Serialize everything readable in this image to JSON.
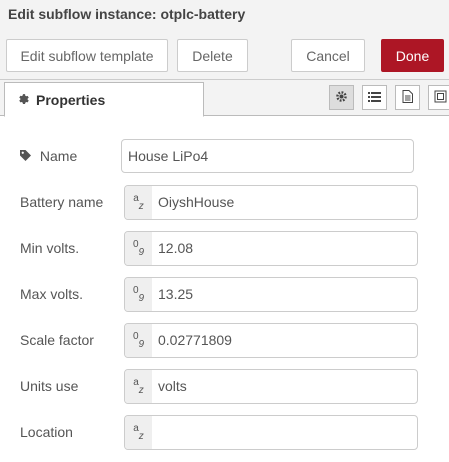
{
  "dialog": {
    "title": "Edit subflow instance: otplc-battery"
  },
  "toolbar": {
    "edit_template_label": "Edit subflow template",
    "delete_label": "Delete",
    "cancel_label": "Cancel",
    "done_label": "Done"
  },
  "tabs": {
    "properties_label": "Properties",
    "icons": [
      "gear-icon",
      "list-icon",
      "document-icon",
      "frame-icon"
    ]
  },
  "form": {
    "name": {
      "label": "Name",
      "value": "House LiPo4"
    },
    "fields": [
      {
        "label": "Battery name",
        "type": "string",
        "type_symbol_top": "a",
        "type_symbol_bottom": "z",
        "value": "OiyshHouse"
      },
      {
        "label": "Min volts.",
        "type": "number",
        "type_symbol_top": "0",
        "type_symbol_bottom": "9",
        "value": "12.08"
      },
      {
        "label": "Max volts.",
        "type": "number",
        "type_symbol_top": "0",
        "type_symbol_bottom": "9",
        "value": "13.25"
      },
      {
        "label": "Scale factor",
        "type": "number",
        "type_symbol_top": "0",
        "type_symbol_bottom": "9",
        "value": "0.02771809"
      },
      {
        "label": "Units use",
        "type": "string",
        "type_symbol_top": "a",
        "type_symbol_bottom": "z",
        "value": "volts"
      },
      {
        "label": "Location",
        "type": "string",
        "type_symbol_top": "a",
        "type_symbol_bottom": "z",
        "value": ""
      }
    ]
  },
  "colors": {
    "primary": "#ad1625",
    "toolbar_bg": "#f3f3f3",
    "border": "#cccccc"
  }
}
